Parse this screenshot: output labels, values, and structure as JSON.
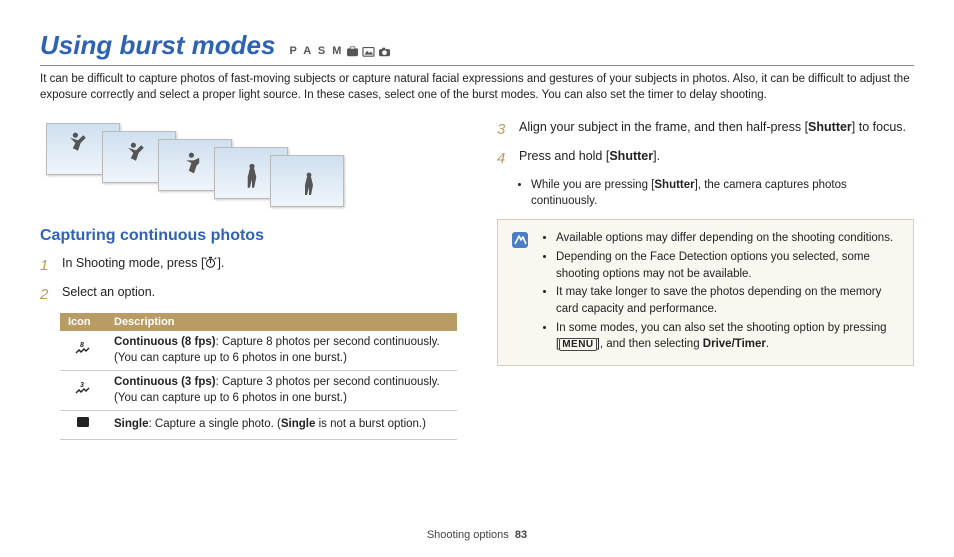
{
  "title": "Using burst modes",
  "mode_letters": "P A S M",
  "intro": "It can be difficult to capture photos of fast-moving subjects or capture natural facial expressions and gestures of your subjects in photos. Also, it can be difficult to adjust the exposure correctly and select a proper light source. In these cases, select one of the burst modes. You can also set the timer to delay shooting.",
  "subtitle": "Capturing continuous photos",
  "steps": {
    "s1": {
      "num": "1",
      "pre": "In Shooting mode, press [",
      "post": "]."
    },
    "s2": {
      "num": "2",
      "text": "Select an option."
    },
    "s3": {
      "num": "3",
      "pre": "Align your subject in the frame, and then half-press [",
      "bold": "Shutter",
      "post": "] to focus."
    },
    "s4": {
      "num": "4",
      "pre": "Press and hold [",
      "bold": "Shutter",
      "post": "]."
    },
    "s4_sub_pre": "While you are pressing [",
    "s4_sub_bold": "Shutter",
    "s4_sub_post": "], the camera captures photos continuously."
  },
  "table": {
    "h1": "Icon",
    "h2": "Description",
    "r1_b": "Continuous (8 fps)",
    "r1_t": ": Capture 8 photos per second continuously. (You can capture up to 6 photos in one burst.)",
    "r2_b": "Continuous (3 fps)",
    "r2_t": ": Capture 3 photos per second continuously. (You can capture up to 6 photos in one burst.)",
    "r3_b": "Single",
    "r3_t": ": Capture a single photo. (",
    "r3_b2": "Single",
    "r3_t2": " is not a burst option.)"
  },
  "notes": {
    "n1": "Available options may differ depending on the shooting conditions.",
    "n2": "Depending on the Face Detection options you selected, some shooting options may not be available.",
    "n3": "It may take longer to save the photos depending on the memory card capacity and performance.",
    "n4_pre": "In some modes, you can also set the shooting option by pressing [",
    "n4_menu": "MENU",
    "n4_mid": "], and then selecting ",
    "n4_bold": "Drive/Timer",
    "n4_post": "."
  },
  "footer": {
    "section": "Shooting options",
    "page": "83"
  }
}
